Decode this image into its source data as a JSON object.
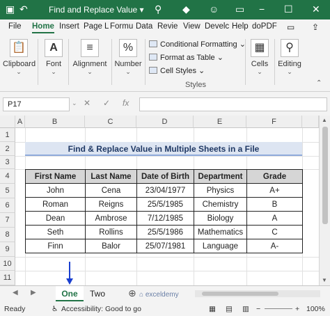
{
  "window": {
    "title": "Find and Replace Value",
    "title_chevron": "▾"
  },
  "tabs": [
    "File",
    "Home",
    "Insert",
    "Page L",
    "Formu",
    "Data",
    "Revie",
    "View",
    "Develc",
    "Help",
    "doPDF"
  ],
  "ribbon": {
    "clipboard": "Clipboard",
    "font": "Font",
    "alignment": "Alignment",
    "number": "Number",
    "conditional_formatting": "Conditional Formatting",
    "format_as_table": "Format as Table",
    "cell_styles": "Cell Styles",
    "styles_group": "Styles",
    "cells": "Cells",
    "editing": "Editing"
  },
  "formula_bar": {
    "name_box": "P17",
    "cancel_symbol": "✕",
    "enter_symbol": "✓",
    "fx_symbol": "fx",
    "value": ""
  },
  "columns": [
    "A",
    "B",
    "C",
    "D",
    "E",
    "F"
  ],
  "rows": [
    "1",
    "2",
    "3",
    "4",
    "5",
    "6",
    "7",
    "8",
    "9",
    "10",
    "11"
  ],
  "sheet": {
    "title": "Find & Replace Value in Multiple Sheets in a File",
    "headers": [
      "First Name",
      "Last Name",
      "Date of Birth",
      "Department",
      "Grade"
    ],
    "data": [
      [
        "John",
        "Cena",
        "23/04/1977",
        "Physics",
        "A+"
      ],
      [
        "Roman",
        "Reigns",
        "25/5/1985",
        "Chemistry",
        "B"
      ],
      [
        "Dean",
        "Ambrose",
        "7/12/1985",
        "Biology",
        "A"
      ],
      [
        "Seth",
        "Rollins",
        "25/5/1986",
        "Mathematics",
        "C"
      ],
      [
        "Finn",
        "Balor",
        "25/07/1981",
        "Language",
        "A-"
      ]
    ]
  },
  "sheet_tabs": [
    "One",
    "Two"
  ],
  "watermark": "exceldemy",
  "status": {
    "ready": "Ready",
    "accessibility": "Accessibility: Good to go",
    "zoom": "100%"
  }
}
